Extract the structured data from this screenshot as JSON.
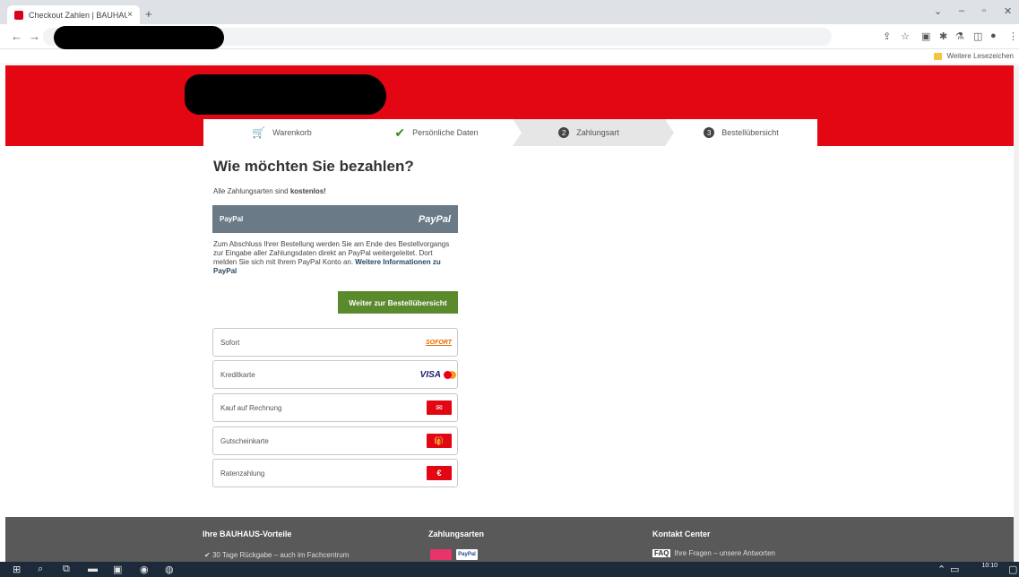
{
  "browser": {
    "tab_title": "Checkout Zahlen | BAUHAUS",
    "tab_close": "×",
    "new_tab": "+",
    "bookmark_label": "Weitere Lesezeichen"
  },
  "steps": [
    {
      "label": "Warenkorb",
      "icon": "cart-icon"
    },
    {
      "label": "Persönliche Daten",
      "icon": "check-icon"
    },
    {
      "label": "Zahlungsart",
      "number": "2"
    },
    {
      "label": "Bestellübersicht",
      "number": "3"
    }
  ],
  "main": {
    "title": "Wie möchten Sie bezahlen?",
    "subline_prefix": "Alle Zahlungsarten sind ",
    "subline_bold": "kostenlos!"
  },
  "paypal": {
    "label": "PayPal",
    "logo": "PayPal",
    "text": "Zum Abschluss Ihrer Bestellung werden Sie am Ende des Bestellvorgangs zur Eingabe aller Zahlungsdaten direkt an PayPal weitergeleitet. Dort melden Sie sich mit Ihrem PayPal Konto an. ",
    "more_link": "Weitere Informationen zu PayPal"
  },
  "continue_button": "Weiter zur Bestellübersicht",
  "payment_options": [
    {
      "label": "Sofort",
      "badge": "SOFORT"
    },
    {
      "label": "Kreditkarte",
      "badge": "VISA"
    },
    {
      "label": "Kauf auf Rechnung",
      "badge": "✉"
    },
    {
      "label": "Gutscheinkarte",
      "badge": "🎁"
    },
    {
      "label": "Ratenzahlung",
      "badge": "€"
    }
  ],
  "footer": {
    "col1_title": "Ihre BAUHAUS-Vorteile",
    "col1_line": "30 Tage Rückgabe – auch im Fachcentrum",
    "col2_title": "Zahlungsarten",
    "col3_title": "Kontakt Center",
    "faq_label": "FAQ",
    "faq_text": "Ihre Fragen – unsere Antworten",
    "paypal_badge": "PayPal"
  },
  "taskbar": {
    "time": "10:10"
  },
  "colors": {
    "brand_red": "#e30613",
    "paypal_bar": "#6b7a87",
    "continue_green": "#5a8a2c",
    "footer_grey": "#595959"
  }
}
